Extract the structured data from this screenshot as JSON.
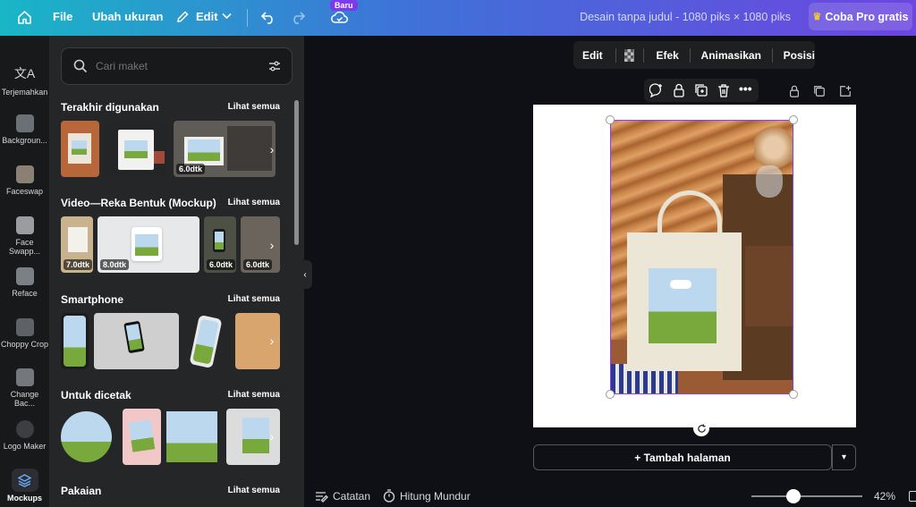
{
  "topbar": {
    "file_label": "File",
    "resize_label": "Ubah ukuran",
    "edit_label": "Edit",
    "new_badge": "Baru",
    "title": "Desain tanpa judul - 1080 piks × 1080 piks",
    "pro_button": "Coba Pro gratis"
  },
  "rail": {
    "items": [
      {
        "label": "Terjemahkan",
        "icon": "translate-icon"
      },
      {
        "label": "Backgroun...",
        "icon": "background-remover-icon"
      },
      {
        "label": "Faceswap",
        "icon": "faceswap-icon"
      },
      {
        "label": "Face Swapp...",
        "icon": "face-swapper-icon"
      },
      {
        "label": "Reface",
        "icon": "reface-icon"
      },
      {
        "label": "Choppy Crop",
        "icon": "choppy-crop-icon"
      },
      {
        "label": "Change Bac...",
        "icon": "change-background-icon"
      },
      {
        "label": "Logo Maker",
        "icon": "logo-maker-icon"
      },
      {
        "label": "Mockups",
        "icon": "mockups-icon"
      }
    ]
  },
  "panel": {
    "search_placeholder": "Cari maket",
    "sections": [
      {
        "title": "Terakhir digunakan",
        "see_all": "Lihat semua",
        "badges": [
          "6.0dtk"
        ]
      },
      {
        "title": "Video—Reka Bentuk (Mockup)",
        "see_all": "Lihat semua",
        "badges": [
          "7.0dtk",
          "8.0dtk",
          "6.0dtk",
          "6.0dtk"
        ]
      },
      {
        "title": "Smartphone",
        "see_all": "Lihat semua"
      },
      {
        "title": "Untuk dicetak",
        "see_all": "Lihat semua"
      },
      {
        "title": "Pakaian",
        "see_all": "Lihat semua"
      }
    ]
  },
  "context_toolbar": {
    "edit": "Edit",
    "effects": "Efek",
    "animate": "Animasikan",
    "position": "Posisi"
  },
  "footer": {
    "add_page": "+ Tambah halaman",
    "notes": "Catatan",
    "timer": "Hitung Mundur",
    "zoom": "42%"
  },
  "colors": {
    "accent": "#8b3dff",
    "topbar_start": "#19b6c6",
    "topbar_end": "#6d45e0"
  }
}
